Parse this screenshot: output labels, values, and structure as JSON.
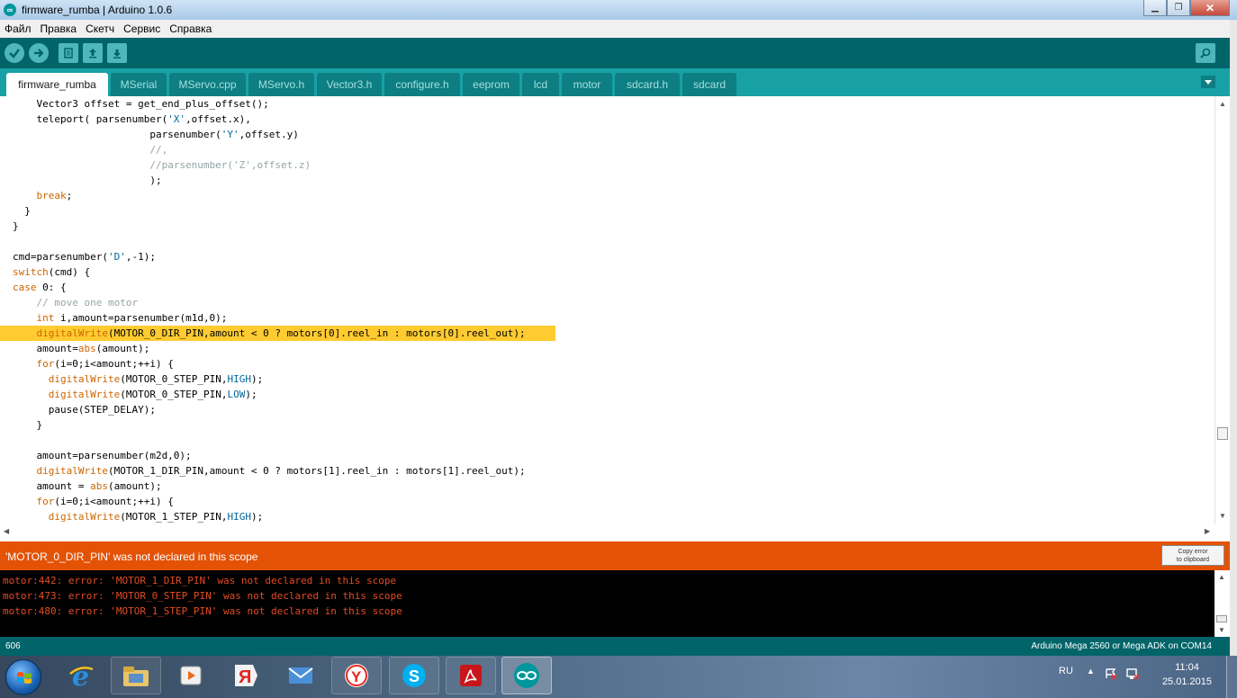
{
  "window": {
    "title": "firmware_rumba | Arduino 1.0.6",
    "minimize": "▁",
    "maximize": "❐",
    "close": "✕"
  },
  "menu": [
    "Файл",
    "Правка",
    "Скетч",
    "Сервис",
    "Справка"
  ],
  "toolbar": {
    "buttons": [
      "verify-icon",
      "upload-icon",
      "new-icon",
      "open-icon",
      "save-icon"
    ],
    "serial_monitor": "serial-monitor-icon"
  },
  "tabs": [
    {
      "label": "firmware_rumba",
      "active": true
    },
    {
      "label": "MSerial"
    },
    {
      "label": "MServo.cpp"
    },
    {
      "label": "MServo.h"
    },
    {
      "label": "Vector3.h"
    },
    {
      "label": "configure.h"
    },
    {
      "label": "eeprom"
    },
    {
      "label": "lcd"
    },
    {
      "label": "motor"
    },
    {
      "label": "sdcard.h"
    },
    {
      "label": "sdcard"
    }
  ],
  "code": [
    "    Vector3 offset = get_end_plus_offset();",
    "    teleport( parsenumber('X',offset.x),",
    "                       parsenumber('Y',offset.y)",
    "                       //,",
    "                       //parsenumber('Z',offset.z)",
    "                       );",
    "    break;",
    "  }",
    "}",
    "",
    "cmd=parsenumber('D',-1);",
    "switch(cmd) {",
    "case 0: {",
    "    // move one motor",
    "    int i,amount=parsenumber(m1d,0);",
    "    digitalWrite(MOTOR_0_DIR_PIN,amount < 0 ? motors[0].reel_in : motors[0].reel_out);",
    "    amount=abs(amount);",
    "    for(i=0;i<amount;++i) {",
    "      digitalWrite(MOTOR_0_STEP_PIN,HIGH);",
    "      digitalWrite(MOTOR_0_STEP_PIN,LOW);",
    "      pause(STEP_DELAY);",
    "    }",
    "",
    "    amount=parsenumber(m2d,0);",
    "    digitalWrite(MOTOR_1_DIR_PIN,amount < 0 ? motors[1].reel_in : motors[1].reel_out);",
    "    amount = abs(amount);",
    "    for(i=0;i<amount;++i) {",
    "      digitalWrite(MOTOR_1_STEP_PIN,HIGH);"
  ],
  "highlighted_line": 15,
  "error": {
    "message": "'MOTOR_0_DIR_PIN' was not declared in this scope",
    "copy_button": "Copy error\nto clipboard"
  },
  "console": [
    "motor:442: error: 'MOTOR_1_DIR_PIN' was not declared in this scope",
    "motor:473: error: 'MOTOR_0_STEP_PIN' was not declared in this scope",
    "motor:480: error: 'MOTOR_1_STEP_PIN' was not declared in this scope"
  ],
  "status": {
    "line": "606",
    "board": "Arduino Mega 2560 or Mega ADK on COM14"
  },
  "taskbar": {
    "apps": [
      "ie-icon",
      "explorer-icon",
      "media-player-icon",
      "yandex-icon",
      "mail-icon",
      "yandex-browser-icon",
      "skype-icon",
      "acrobat-icon",
      "arduino-icon"
    ],
    "language": "RU",
    "time": "11:04",
    "date": "25.01.2015"
  },
  "colors": {
    "toolbar": "#006468",
    "tabbar": "#17a1a5",
    "error_bar": "#e35205",
    "highlight": "#ffcb30",
    "console_text": "#e34c22"
  }
}
